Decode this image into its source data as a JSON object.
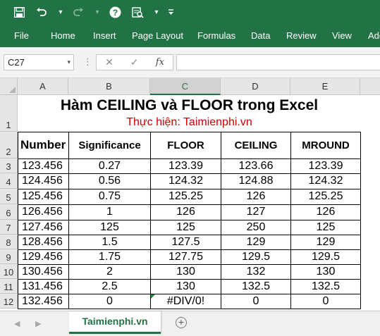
{
  "quick_access": {
    "icons": [
      "save-icon",
      "undo-icon",
      "redo-icon",
      "help-icon",
      "print-preview-icon",
      "customize-qat-icon"
    ]
  },
  "ribbon": {
    "tabs": [
      "File",
      "Home",
      "Insert",
      "Page Layout",
      "Formulas",
      "Data",
      "Review",
      "View",
      "Add"
    ]
  },
  "formula_bar": {
    "name_box": "C27",
    "cancel_glyph": "✕",
    "enter_glyph": "✓",
    "fx_glyph": "fx",
    "formula": ""
  },
  "grid": {
    "columns": [
      "A",
      "B",
      "C",
      "D",
      "E"
    ],
    "selected_column": "C",
    "rows": [
      "1",
      "2",
      "3",
      "4",
      "5",
      "6",
      "7",
      "8",
      "9",
      "10",
      "11",
      "12"
    ]
  },
  "sheet": {
    "title": "Hàm CEILING và FLOOR trong Excel",
    "subtitle": "Thực hiện: Taimienphi.vn",
    "headers": [
      "Number",
      "Significance",
      "FLOOR",
      "CEILING",
      "MROUND"
    ],
    "data": [
      [
        "123.456",
        "0.27",
        "123.39",
        "123.66",
        "123.39"
      ],
      [
        "124.456",
        "0.56",
        "124.32",
        "124.88",
        "124.32"
      ],
      [
        "125.456",
        "0.75",
        "125.25",
        "126",
        "125.25"
      ],
      [
        "126.456",
        "1",
        "126",
        "127",
        "126"
      ],
      [
        "127.456",
        "125",
        "125",
        "250",
        "125"
      ],
      [
        "128.456",
        "1.5",
        "127.5",
        "129",
        "129"
      ],
      [
        "129.456",
        "1.75",
        "127.75",
        "129.5",
        "129.5"
      ],
      [
        "130.456",
        "2",
        "130",
        "132",
        "130"
      ],
      [
        "131.456",
        "2.5",
        "130",
        "132.5",
        "132.5"
      ],
      [
        "132.456",
        "0",
        "#DIV/0!",
        "0",
        "0"
      ]
    ]
  },
  "sheet_tabs": {
    "active": "Taimienphi.vn",
    "add_glyph": "+"
  },
  "colors": {
    "excel_green": "#217346",
    "subtitle_red": "#d10000"
  }
}
